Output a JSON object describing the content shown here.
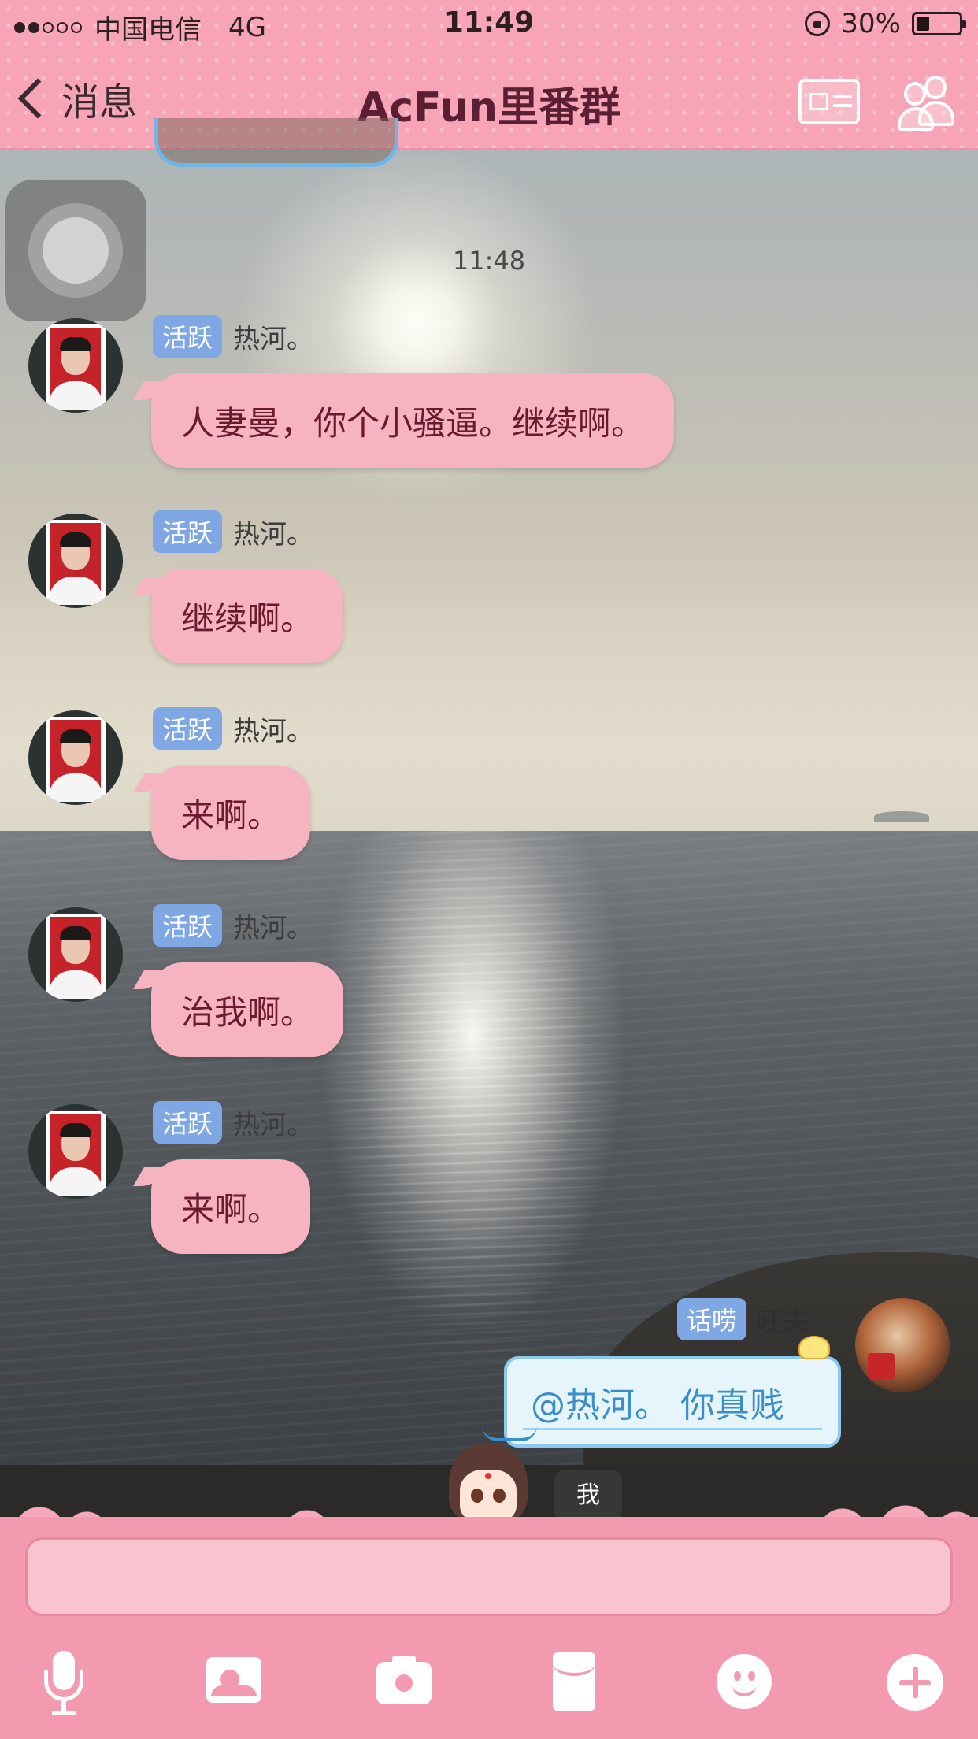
{
  "status_bar": {
    "carrier": "中国电信",
    "network": "4G",
    "time": "11:49",
    "battery": "30%",
    "battery_level": 0.3,
    "signal_bars_filled": 2,
    "signal_bars_total": 5
  },
  "nav": {
    "back_label": "消息",
    "title": "AcFun里番群"
  },
  "chat": {
    "timestamp": "11:48",
    "messages": [
      {
        "badge": "活跃",
        "sender": "热河。",
        "text": "人妻曼，你个小骚逼。继续啊。"
      },
      {
        "badge": "活跃",
        "sender": "热河。",
        "text": "继续啊。"
      },
      {
        "badge": "活跃",
        "sender": "热河。",
        "text": "来啊。"
      },
      {
        "badge": "活跃",
        "sender": "热河。",
        "text": "治我啊。"
      },
      {
        "badge": "活跃",
        "sender": "热河。",
        "text": "来啊。"
      }
    ],
    "my_message": {
      "badge": "话唠",
      "sender": "旺夫",
      "text": "@热河。 你真贱"
    },
    "me_tip": "我"
  },
  "input": {
    "placeholder": ""
  },
  "colors": {
    "header_pink": "#f6a4b6",
    "bubble_pink": "#f6b4c0",
    "badge_blue": "#7fa7e3",
    "title_text": "#5a1f33",
    "my_bubble_text": "#3a8ec9"
  },
  "icons": [
    "back-chevron-icon",
    "group-card-icon",
    "group-members-icon",
    "microphone-icon",
    "picture-icon",
    "camera-icon",
    "red-packet-icon",
    "emoji-icon",
    "plus-icon",
    "lock-rotation-icon",
    "battery-icon",
    "signal-icon"
  ]
}
